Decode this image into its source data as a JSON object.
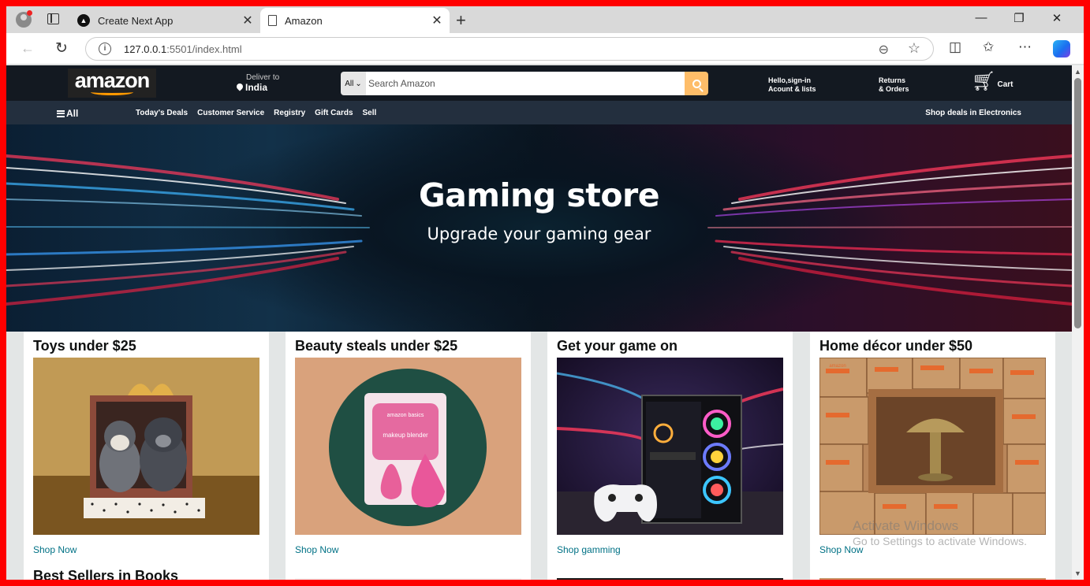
{
  "browser": {
    "tabs": [
      {
        "title": "Create Next App",
        "icon": "nextjs-favicon-icon"
      },
      {
        "title": "Amazon",
        "icon": "page-icon",
        "active": true
      }
    ],
    "url_host": "127.0.0.1",
    "url_rest": ":5501/index.html",
    "icons": [
      "profile-icon",
      "tab-actions-icon",
      "new-tab-icon",
      "back-icon",
      "reload-icon",
      "site-info-icon",
      "zoom-icon",
      "favorite-star-icon",
      "split-screen-icon",
      "favorites-icon",
      "more-icon",
      "copilot-icon",
      "minimize-icon",
      "restore-icon",
      "close-window-icon"
    ]
  },
  "header": {
    "logo": "amazon",
    "deliver_label": "Deliver to",
    "deliver_location": "India",
    "search_category": "All",
    "search_placeholder": "Search Amazon",
    "account_line1": "Hello,sign-in",
    "account_line2": "Acount & lists",
    "returns_line1": "Returns",
    "returns_line2": "& Orders",
    "cart_label": "Cart",
    "accent_color": "#febd69"
  },
  "subnav": {
    "all_label": "All",
    "links": [
      "Today's Deals",
      "Customer Service",
      "Registry",
      "Gift Cards",
      "Sell"
    ],
    "right_link": "Shop deals in Electronics"
  },
  "hero": {
    "title": "Gaming store",
    "subtitle": "Upgrade your gaming gear"
  },
  "cards": [
    {
      "title": "Toys under $25",
      "link": "Shop Now"
    },
    {
      "title": "Beauty steals under $25",
      "link": "Shop Now"
    },
    {
      "title": "Get your game on",
      "link": "Shop gamming"
    },
    {
      "title": "Home décor under $50",
      "link": "Shop Now"
    }
  ],
  "next_row": {
    "title": "Best Sellers in Books"
  },
  "product_image_text": {
    "brand": "amazon basics",
    "product": "makeup blender",
    "box_brand": "amazon"
  },
  "watermark": {
    "line1": "Activate Windows",
    "line2": "Go to Settings to activate Windows."
  }
}
